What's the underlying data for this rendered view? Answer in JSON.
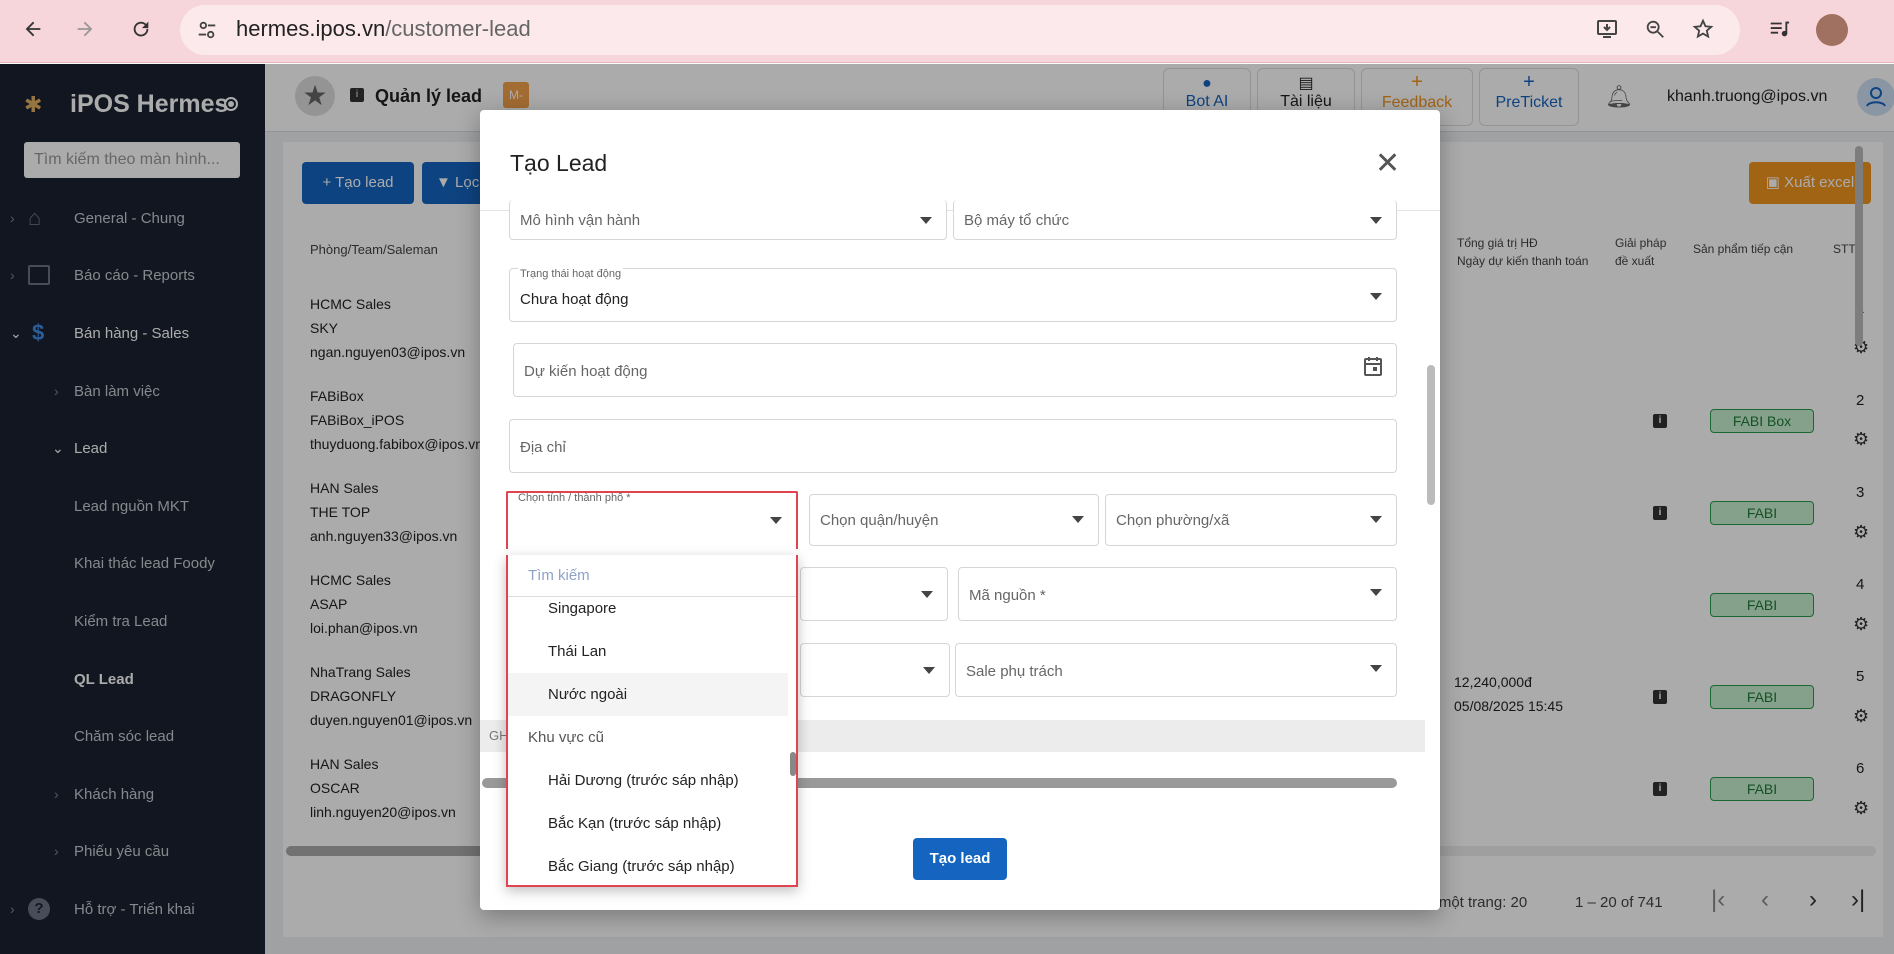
{
  "browser": {
    "url_host": "hermes.ipos.vn",
    "url_path": "/customer-lead"
  },
  "sidebar": {
    "brand": "iPOS Hermes",
    "search_placeholder": "Tìm kiếm theo màn hình...",
    "items": [
      {
        "label": "General - Chung"
      },
      {
        "label": "Báo cáo - Reports"
      },
      {
        "label": "Bán hàng - Sales"
      },
      {
        "label": "Bàn làm việc"
      },
      {
        "label": "Lead"
      },
      {
        "label": "Lead nguồn MKT"
      },
      {
        "label": "Khai thác lead Foody"
      },
      {
        "label": "Kiểm tra Lead"
      },
      {
        "label": "QL Lead"
      },
      {
        "label": "Chăm sóc lead"
      },
      {
        "label": "Khách hàng"
      },
      {
        "label": "Phiếu yêu cầu"
      },
      {
        "label": "Hỗ trợ - Triển khai"
      }
    ]
  },
  "header": {
    "title": "Quản lý lead",
    "tag": "M-",
    "bot_ai": "Bot AI",
    "docs": "Tài liệu",
    "feedback": "Feedback",
    "preticket": "PreTicket",
    "user_email": "khanh.truong@ipos.vn"
  },
  "toolbar": {
    "create_lead": "Tạo lead",
    "filter": "Lọc",
    "export": "Xuất excel"
  },
  "table": {
    "col_team": "Phòng/Team/Saleman",
    "col_contract_1": "Tổng giá trị HĐ",
    "col_contract_2": "Ngày dự kiến thanh toán",
    "col_solution_1": "Giải pháp",
    "col_solution_2": "đề xuất",
    "col_product": "Sản phẩm tiếp cận",
    "col_stt": "STT",
    "rows": [
      {
        "team": "HCMC Sales",
        "sub": "SKY",
        "email": "ngan.nguyen03@ipos.vn",
        "stt": "1",
        "product": "",
        "contract": "",
        "date": ""
      },
      {
        "team": "FABiBox",
        "sub": "FABiBox_iPOS",
        "email": "thuyduong.fabibox@ipos.vn",
        "stt": "2",
        "product": "FABI Box",
        "contract": "",
        "date": ""
      },
      {
        "team": "HAN Sales",
        "sub": "THE TOP",
        "email": "anh.nguyen33@ipos.vn",
        "stt": "3",
        "product": "FABI",
        "contract": "",
        "date": ""
      },
      {
        "team": "HCMC Sales",
        "sub": "ASAP",
        "email": "loi.phan@ipos.vn",
        "stt": "4",
        "product": "FABI",
        "contract": "",
        "date": ""
      },
      {
        "team": "NhaTrang Sales",
        "sub": "DRAGONFLY",
        "email": "duyen.nguyen01@ipos.vn",
        "stt": "5",
        "product": "FABI",
        "contract": "12,240,000đ",
        "date": "05/08/2025 15:45"
      },
      {
        "team": "HAN Sales",
        "sub": "OSCAR",
        "email": "linh.nguyen20@ipos.vn",
        "stt": "6",
        "product": "FABI",
        "contract": "",
        "date": ""
      }
    ]
  },
  "pagination": {
    "per_page": "hi một trang: 20",
    "range": "1 – 20 of 741"
  },
  "modal": {
    "title": "Tạo Lead",
    "operating_model": "Mô hình vận hành",
    "org_structure": "Bộ máy tổ chức",
    "status_label": "Trạng thái hoạt động",
    "status_value": "Chưa hoạt động",
    "expected_active": "Dự kiến hoạt động",
    "address": "Địa chỉ",
    "province_label": "Chọn tỉnh / thành phố *",
    "district": "Chọn quận/huyện",
    "ward": "Chọn phường/xã",
    "source_code": "Mã nguồn *",
    "sale_owner": "Sale phụ trách",
    "note_prefix": "GH",
    "submit": "Tạo lead"
  },
  "dropdown": {
    "search_placeholder": "Tìm kiếm",
    "options": [
      {
        "label": "Singapore",
        "type": "option"
      },
      {
        "label": "Thái Lan",
        "type": "option"
      },
      {
        "label": "Nước ngoài",
        "type": "option"
      },
      {
        "label": "Khu vực cũ",
        "type": "group"
      },
      {
        "label": "Hải Dương (trước sáp nhập)",
        "type": "option"
      },
      {
        "label": "Bắc Kạn (trước sáp nhập)",
        "type": "option"
      },
      {
        "label": "Bắc Giang (trước sáp nhập)",
        "type": "option"
      }
    ]
  },
  "colors": {
    "primary": "#1565c0",
    "sidebar_bg": "#1b2230",
    "export_orange": "#f0941f",
    "badge_green": "#c8f0cf",
    "dropdown_outline": "#e0444e"
  }
}
